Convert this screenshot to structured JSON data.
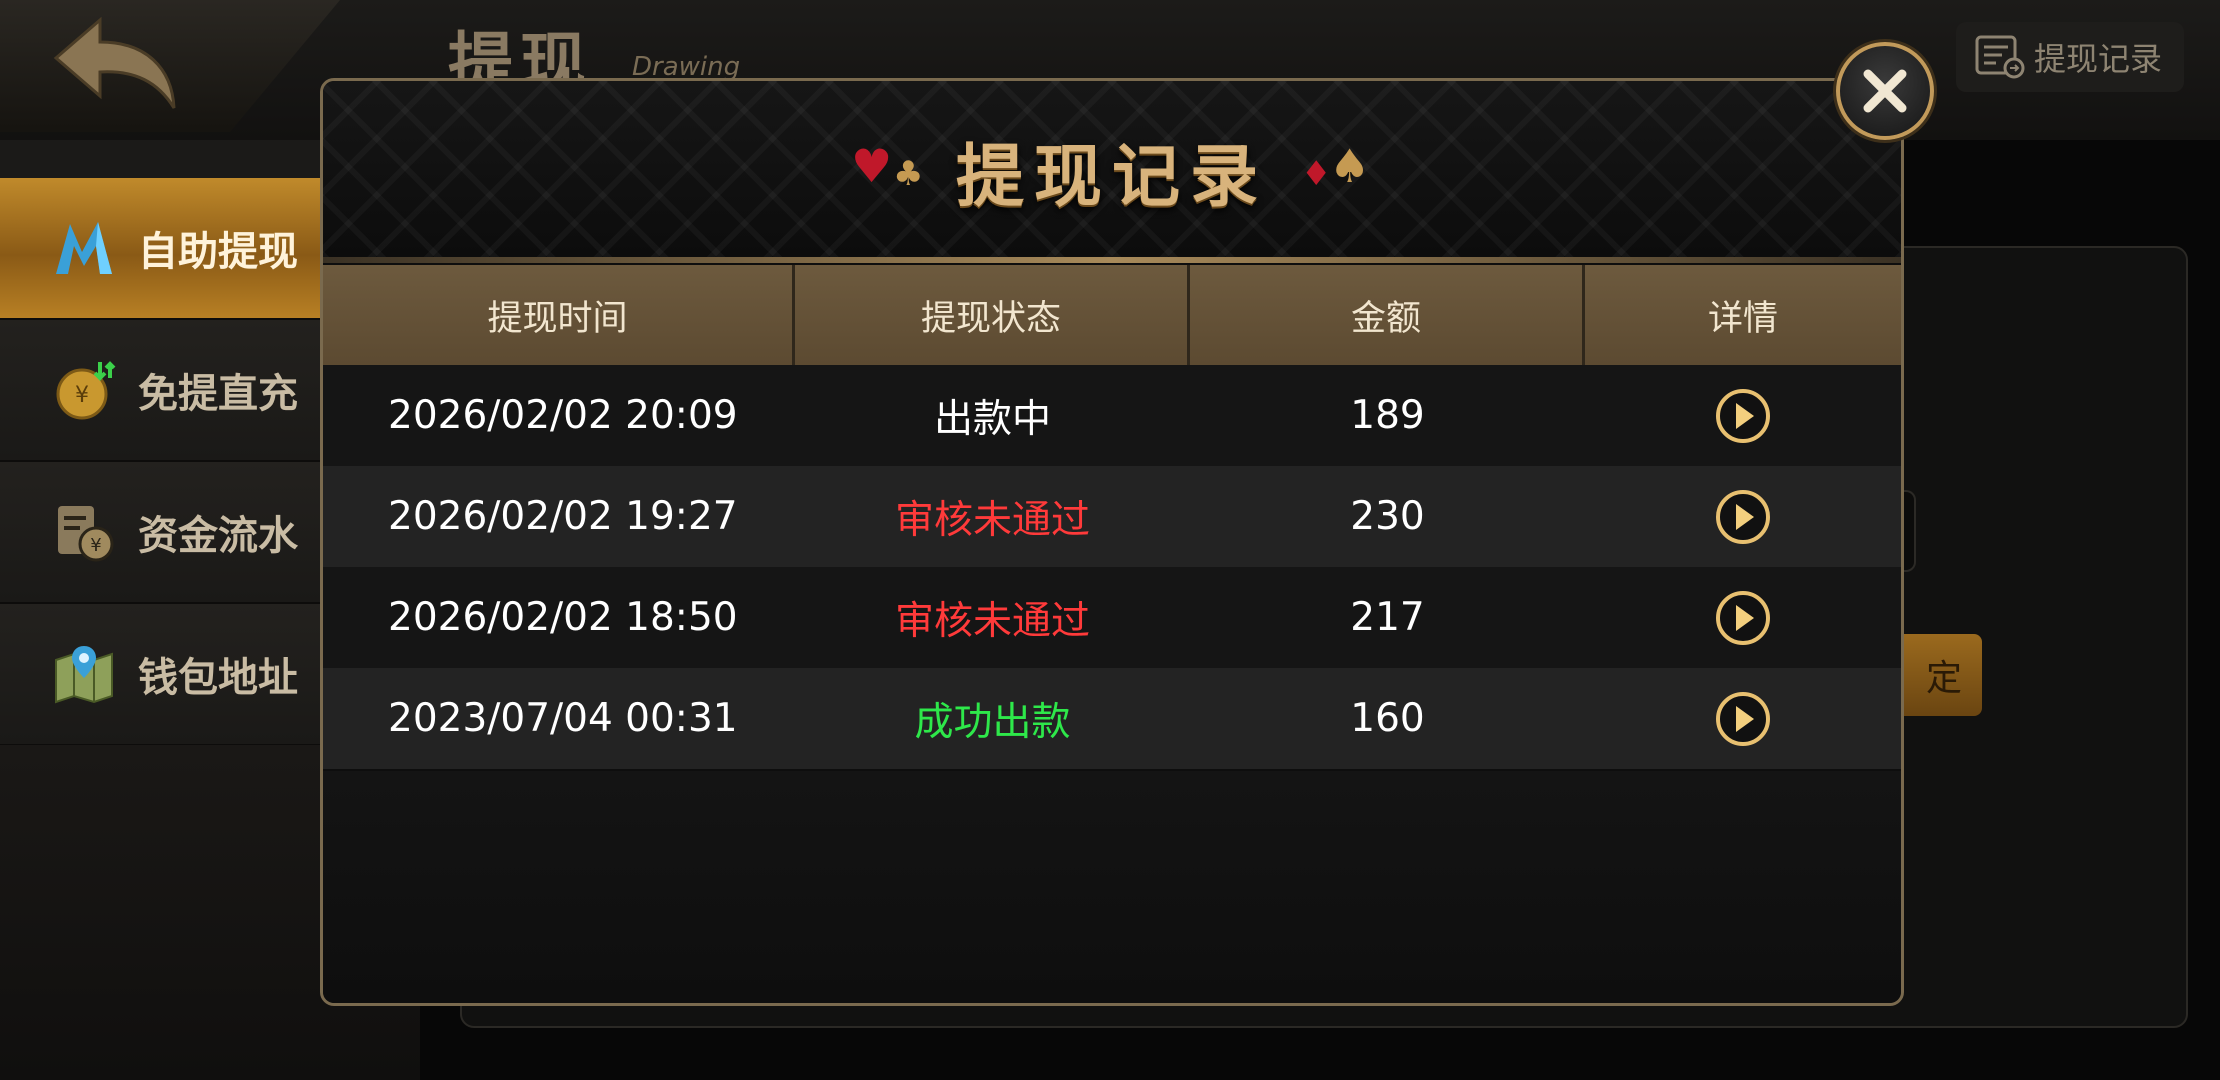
{
  "header": {
    "title": "提现",
    "subtitle": "Drawing",
    "records_button_label": "提现记录"
  },
  "sidebar": {
    "items": [
      {
        "label": "自助提现",
        "icon": "brand-m-icon",
        "active": true
      },
      {
        "label": "免提直充",
        "icon": "coin-recharge-icon",
        "active": false
      },
      {
        "label": "资金流水",
        "icon": "fund-statement-icon",
        "active": false
      },
      {
        "label": "钱包地址",
        "icon": "wallet-map-icon",
        "active": false
      }
    ]
  },
  "background": {
    "confirm_partial_label": "定"
  },
  "modal": {
    "title": "提现记录",
    "columns": [
      "提现时间",
      "提现状态",
      "金额",
      "详情"
    ],
    "rows": [
      {
        "time": "2026/02/02 20:09",
        "status": "出款中",
        "status_color": "#ffffff",
        "amount": "189"
      },
      {
        "time": "2026/02/02 19:27",
        "status": "审核未通过",
        "status_color": "#ff3a3a",
        "amount": "230"
      },
      {
        "time": "2026/02/02 18:50",
        "status": "审核未通过",
        "status_color": "#ff3a3a",
        "amount": "217"
      },
      {
        "time": "2023/07/04 00:31",
        "status": "成功出款",
        "status_color": "#2ee84a",
        "amount": "160"
      }
    ]
  },
  "colors": {
    "accent_gold": "#d8b37c",
    "header_bar": "#6d5a3e"
  }
}
